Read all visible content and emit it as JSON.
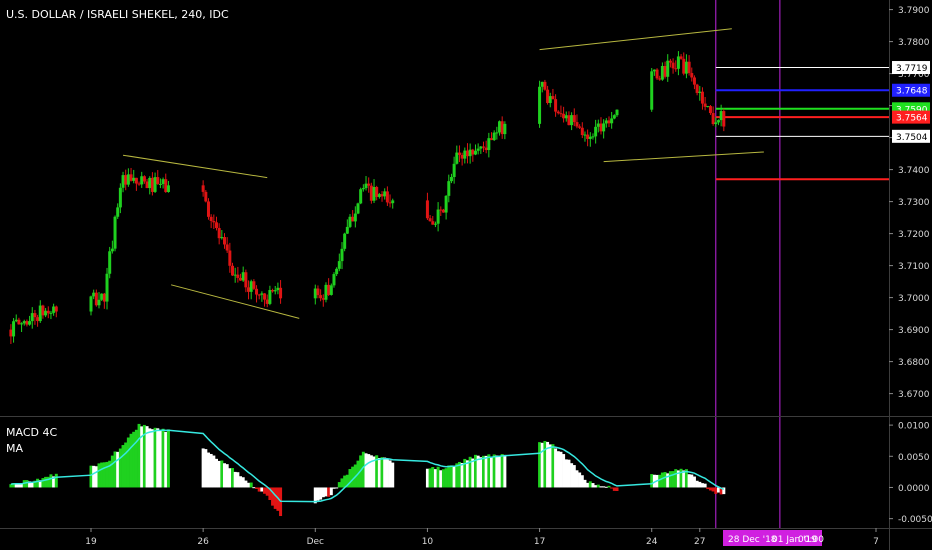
{
  "chart_data": [
    {
      "type": "candlestick",
      "title": "U.S. DOLLAR / ISRAELI SHEKEL, 240, IDC",
      "ylim": [
        3.663,
        3.793
      ],
      "y_ticks": [
        "3.7900",
        "3.7800",
        "3.7700",
        "3.7600",
        "3.7500",
        "3.7400",
        "3.7300",
        "3.7200",
        "3.7100",
        "3.7000",
        "3.6900",
        "3.6800",
        "3.6700"
      ],
      "y_tick_values": [
        3.79,
        3.78,
        3.77,
        3.76,
        3.75,
        3.74,
        3.73,
        3.72,
        3.71,
        3.7,
        3.69,
        3.68,
        3.67
      ],
      "x_ticks": [
        "19",
        "26",
        "Dec",
        "10",
        "17",
        "24",
        "27",
        "7"
      ],
      "x_tick_dates": [
        "2018-11-19",
        "2018-11-26",
        "2018-12-03",
        "2018-12-10",
        "2018-12-17",
        "2018-12-24",
        "2018-12-27",
        "2019-01-07"
      ],
      "date_label": "28 Dec '18",
      "date_label_2": "01 Jan '19",
      "time_label": "00:00",
      "series": [
        {
          "key": "close_path",
          "dates": [
            "2018-11-14",
            "2018-11-16",
            "2018-11-20",
            "2018-11-21",
            "2018-11-26",
            "2018-11-28",
            "2018-11-30",
            "2018-12-04",
            "2018-12-06",
            "2018-12-09",
            "2018-12-11",
            "2018-12-12",
            "2018-12-14",
            "2018-12-17",
            "2018-12-18",
            "2018-12-20",
            "2018-12-24",
            "2018-12-26",
            "2018-12-28"
          ],
          "values": [
            3.69,
            3.695,
            3.7,
            3.736,
            3.734,
            3.708,
            3.7,
            3.702,
            3.734,
            3.727,
            3.725,
            3.744,
            3.748,
            3.768,
            3.761,
            3.75,
            3.768,
            3.774,
            3.756
          ]
        }
      ],
      "price_levels": [
        {
          "label": "3.7719",
          "value": 3.7719,
          "color": "#ffffff"
        },
        {
          "label": "3.7648",
          "value": 3.7648,
          "color": "#2121ff"
        },
        {
          "label": "3.7590",
          "value": 3.759,
          "color": "#1fe01f"
        },
        {
          "label": "3.7564",
          "value": 3.7564,
          "color": "#ff1f1f"
        },
        {
          "label": "3.7504",
          "value": 3.7504,
          "color": "#ffffff"
        },
        {
          "label": "",
          "value": 3.737,
          "color": "#ff1f1f"
        }
      ],
      "trend_lines": [
        {
          "from": [
            "2018-11-21",
            3.7445
          ],
          "to": [
            "2018-11-30",
            3.7375
          ]
        },
        {
          "from": [
            "2018-11-24",
            3.704
          ],
          "to": [
            "2018-12-02",
            3.6935
          ]
        },
        {
          "from": [
            "2018-12-17",
            3.7775
          ],
          "to": [
            "2018-12-29",
            3.784
          ]
        },
        {
          "from": [
            "2018-12-21",
            3.7425
          ],
          "to": [
            "2018-12-31",
            3.7455
          ]
        }
      ],
      "vertical_markers": [
        "2018-12-28",
        "2019-01-01"
      ],
      "colors": {
        "up": "#1fd11f",
        "down": "#e01414",
        "trend": "#b8b840",
        "marker": "#c025e0"
      }
    },
    {
      "type": "histogram",
      "title": "MACD 4C",
      "series_label": "MA",
      "ylim": [
        -0.0065,
        0.0113
      ],
      "y_ticks": [
        "0.0100",
        "0.0050",
        "0.0000",
        "-0.0050"
      ],
      "y_tick_values": [
        0.01,
        0.005,
        0.0,
        -0.005
      ],
      "macd_anchor_dates": [
        "2018-11-14",
        "2018-11-16",
        "2018-11-20",
        "2018-11-22",
        "2018-11-25",
        "2018-11-28",
        "2018-11-30",
        "2018-12-01",
        "2018-12-04",
        "2018-12-06",
        "2018-12-09",
        "2018-12-11",
        "2018-12-13",
        "2018-12-15",
        "2018-12-17",
        "2018-12-18",
        "2018-12-20",
        "2018-12-22",
        "2018-12-24",
        "2018-12-26",
        "2018-12-28"
      ],
      "macd_anchor_values": [
        0.0005,
        0.0015,
        0.004,
        0.01,
        0.0085,
        0.0025,
        -0.0015,
        -0.005,
        -0.001,
        0.0055,
        0.0035,
        0.003,
        0.005,
        0.0055,
        0.0075,
        0.0065,
        0.001,
        -0.0005,
        0.002,
        0.003,
        -0.001
      ],
      "colors": {
        "above_rising": "#1fd11f",
        "above_falling": "#ffffff",
        "below_falling": "#e01414",
        "below_rising": "#ffffff",
        "signal": "#36e8e0"
      }
    }
  ]
}
